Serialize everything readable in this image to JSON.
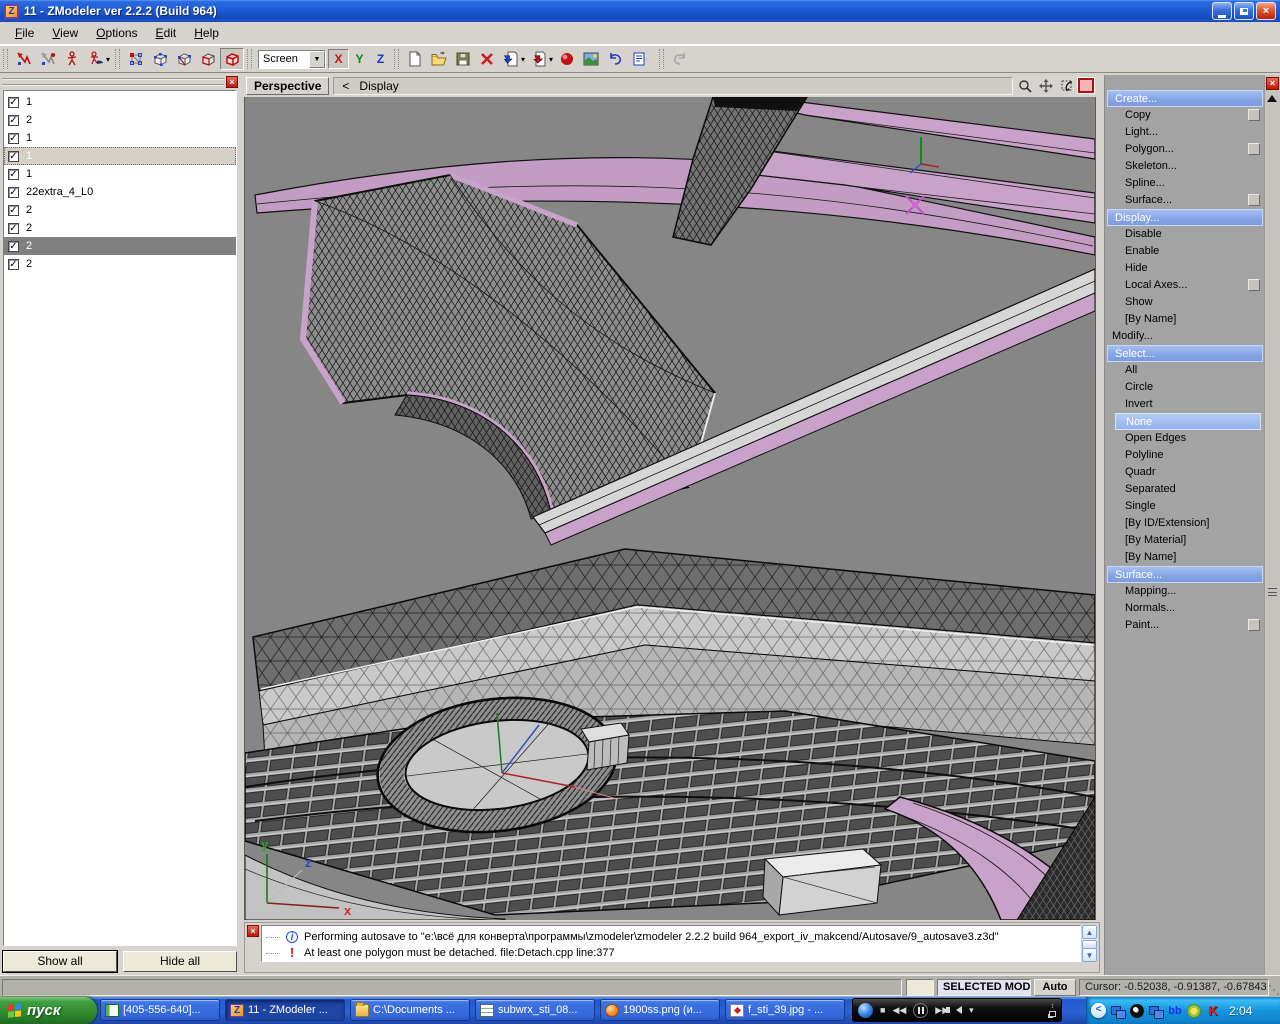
{
  "window": {
    "title": "11 - ZModeler ver 2.2.2 (Build 964)"
  },
  "menubar": {
    "items": [
      {
        "label": "File"
      },
      {
        "label": "View"
      },
      {
        "label": "Options"
      },
      {
        "label": "Edit"
      },
      {
        "label": "Help"
      }
    ]
  },
  "toolbar": {
    "view_mode": "Screen",
    "axis": [
      "X",
      "Y",
      "Z"
    ]
  },
  "object_list": {
    "items": [
      {
        "label": "1",
        "checked": true,
        "state": "normal"
      },
      {
        "label": "2",
        "checked": true,
        "state": "normal"
      },
      {
        "label": "1",
        "checked": true,
        "state": "normal"
      },
      {
        "label": "1",
        "checked": true,
        "state": "focused"
      },
      {
        "label": "1",
        "checked": true,
        "state": "normal"
      },
      {
        "label": "22extra_4_L0",
        "checked": true,
        "state": "normal"
      },
      {
        "label": "2",
        "checked": true,
        "state": "normal"
      },
      {
        "label": "2",
        "checked": true,
        "state": "normal"
      },
      {
        "label": "2",
        "checked": true,
        "state": "selected"
      },
      {
        "label": "2",
        "checked": true,
        "state": "normal"
      }
    ],
    "show_all_label": "Show all",
    "hide_all_label": "Hide all"
  },
  "viewport": {
    "view_label": "Perspective",
    "breadcrumb_arrow": "<",
    "breadcrumb": "Display"
  },
  "command_panel": {
    "items": [
      {
        "label": "Create...",
        "type": "header"
      },
      {
        "label": "Copy",
        "type": "item",
        "has_button": true
      },
      {
        "label": "Light...",
        "type": "item"
      },
      {
        "label": "Polygon...",
        "type": "item",
        "has_button": true
      },
      {
        "label": "Skeleton...",
        "type": "item"
      },
      {
        "label": "Spline...",
        "type": "item"
      },
      {
        "label": "Surface...",
        "type": "item",
        "has_button": true
      },
      {
        "label": "Display...",
        "type": "header"
      },
      {
        "label": "Disable",
        "type": "item"
      },
      {
        "label": "Enable",
        "type": "item"
      },
      {
        "label": "Hide",
        "type": "item"
      },
      {
        "label": "Local Axes...",
        "type": "item",
        "has_button": true
      },
      {
        "label": "Show",
        "type": "item"
      },
      {
        "label": "[By Name]",
        "type": "item"
      },
      {
        "label": "Modify...",
        "type": "plain"
      },
      {
        "label": "Select...",
        "type": "header"
      },
      {
        "label": "All",
        "type": "item"
      },
      {
        "label": "Circle",
        "type": "item"
      },
      {
        "label": "Invert",
        "type": "item"
      },
      {
        "label": "None",
        "type": "selected"
      },
      {
        "label": "Open Edges",
        "type": "item"
      },
      {
        "label": "Polyline",
        "type": "item"
      },
      {
        "label": "Quadr",
        "type": "item"
      },
      {
        "label": "Separated",
        "type": "item"
      },
      {
        "label": "Single",
        "type": "item"
      },
      {
        "label": "[By ID/Extension]",
        "type": "item"
      },
      {
        "label": "[By Material]",
        "type": "item"
      },
      {
        "label": "[By Name]",
        "type": "item"
      },
      {
        "label": "Surface...",
        "type": "header"
      },
      {
        "label": "Mapping...",
        "type": "item"
      },
      {
        "label": "Normals...",
        "type": "item"
      },
      {
        "label": "Paint...",
        "type": "item",
        "has_button": true
      }
    ]
  },
  "log_panel": {
    "lines": [
      {
        "icon": "info",
        "text": "Performing autosave to \"e:\\всё для конверта\\программы\\zmodeler\\zmodeler 2.2.2 build 964_export_iv_makcend/Autosave/9_autosave3.z3d\""
      },
      {
        "icon": "warning",
        "text": "At least one polygon must be detached. file:Detach.cpp line:377"
      }
    ]
  },
  "status_bar": {
    "mode": "SELECTED MODE",
    "auto_label": "Auto",
    "cursor": "Cursor: -0.52038, -0.91387, -0.67843"
  },
  "taskbar": {
    "start_label": "пуск",
    "items": [
      {
        "icon": "card",
        "label": "[405-556-640]...",
        "active": false
      },
      {
        "icon": "zmodeler",
        "label": "11 - ZModeler ...",
        "active": true
      },
      {
        "icon": "folder",
        "label": "C:\\Documents ...",
        "active": false
      },
      {
        "icon": "stack",
        "label": "subwrx_sti_08...",
        "active": false
      },
      {
        "icon": "firefox",
        "label": "1900ss.png (и...",
        "active": false
      },
      {
        "icon": "viewer",
        "label": "f_sti_39.jpg - ...",
        "active": false
      }
    ],
    "clock": "2:04"
  }
}
